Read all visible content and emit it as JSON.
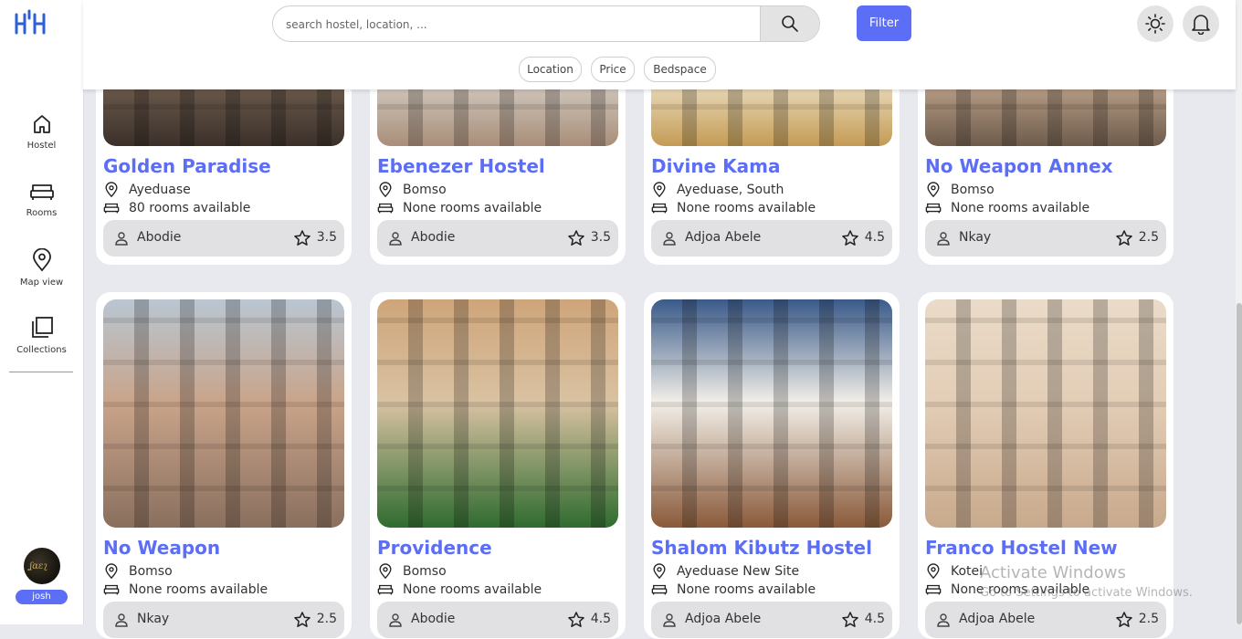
{
  "nav": {
    "items": [
      {
        "label": "Hostel"
      },
      {
        "label": "Rooms"
      },
      {
        "label": "Map view"
      },
      {
        "label": "Collections"
      }
    ],
    "user": {
      "name": "josh"
    }
  },
  "header": {
    "search_placeholder": "search hostel, location, ...",
    "filter_label": "Filter",
    "chips": [
      "Location",
      "Price",
      "Bedspace"
    ]
  },
  "colors": {
    "accent": "#5b6ef5",
    "card_bg": "#ffffff",
    "page_bg": "#e8e9ef"
  },
  "hostels": [
    {
      "name": "Golden Paradise",
      "location": "Ayeduase",
      "rooms": "80 rooms available",
      "owner": "Abodie",
      "rating": "3.5"
    },
    {
      "name": "Ebenezer Hostel",
      "location": "Bomso",
      "rooms": "None rooms available",
      "owner": "Abodie",
      "rating": "3.5"
    },
    {
      "name": "Divine Kama",
      "location": "Ayeduase, South",
      "rooms": "None rooms available",
      "owner": "Adjoa Abele",
      "rating": "4.5"
    },
    {
      "name": "No Weapon Annex",
      "location": "Bomso",
      "rooms": "None rooms available",
      "owner": "Nkay",
      "rating": "2.5"
    },
    {
      "name": "No Weapon",
      "location": "Bomso",
      "rooms": "None rooms available",
      "owner": "Nkay",
      "rating": "2.5"
    },
    {
      "name": "Providence",
      "location": "Bomso",
      "rooms": "None rooms available",
      "owner": "Abodie",
      "rating": "4.5"
    },
    {
      "name": "Shalom Kibutz Hostel",
      "location": "Ayeduase New Site",
      "rooms": "None rooms available",
      "owner": "Adjoa Abele",
      "rating": "4.5"
    },
    {
      "name": "Franco Hostel New",
      "location": "Kotei",
      "rooms": "None rooms available",
      "owner": "Adjoa Abele",
      "rating": "2.5"
    }
  ],
  "watermark": {
    "line1": "Activate Windows",
    "line2": "Go to Settings to activate Windows."
  }
}
